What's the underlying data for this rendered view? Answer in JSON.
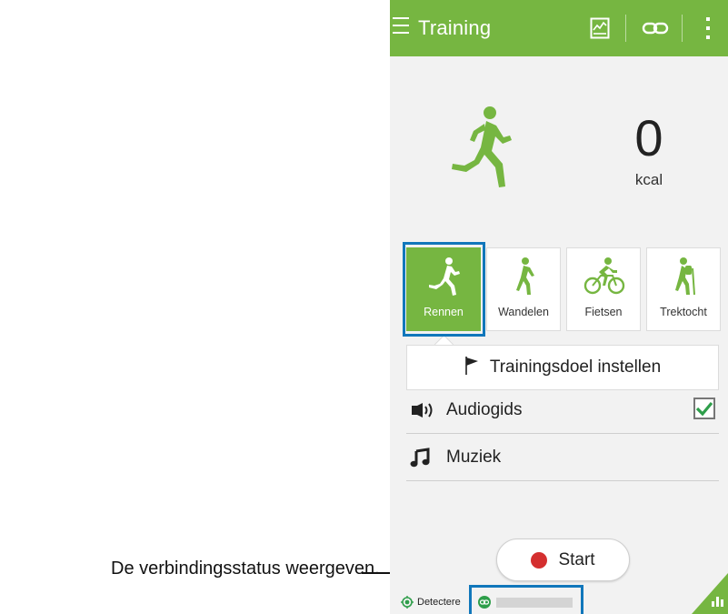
{
  "callout": {
    "text": "De verbindingsstatus weergeven."
  },
  "actionbar": {
    "title": "Training",
    "icons": [
      "menu-icon",
      "chart-icon",
      "link-icon",
      "overflow-menu-icon"
    ]
  },
  "summary": {
    "value": "0",
    "unit": "kcal",
    "figure_icon": "runner-icon"
  },
  "activities": [
    {
      "label": "Rennen",
      "icon": "runner-icon",
      "selected": true
    },
    {
      "label": "Wandelen",
      "icon": "walker-icon",
      "selected": false
    },
    {
      "label": "Fietsen",
      "icon": "cyclist-icon",
      "selected": false
    },
    {
      "label": "Trektocht",
      "icon": "hiker-icon",
      "selected": false
    }
  ],
  "goal": {
    "label": "Trainingsdoel instellen",
    "icon": "flag-icon"
  },
  "options": [
    {
      "label": "Audiogids",
      "icon": "speaker-icon",
      "checked": true
    },
    {
      "label": "Muziek",
      "icon": "music-note-icon"
    }
  ],
  "start": {
    "label": "Start"
  },
  "status": {
    "gps_label": "Detectere",
    "connection_icon": "link-icon"
  },
  "colors": {
    "accent": "#76b641",
    "highlight": "#1177bb",
    "record": "#d42f2f",
    "check": "#2e9e4a"
  }
}
